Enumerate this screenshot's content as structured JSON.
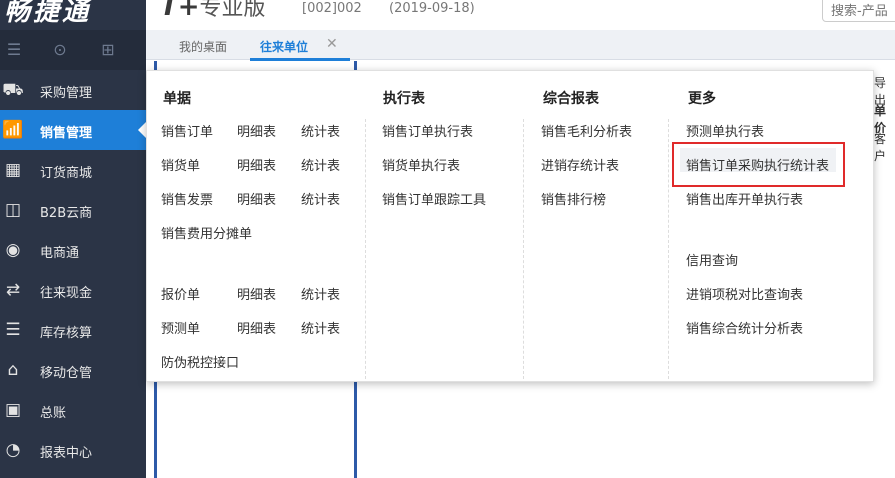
{
  "header": {
    "logo": "畅捷通",
    "product": "T+",
    "edition": "专业版",
    "account": "[002]002",
    "date": "(2019-09-18)",
    "search_placeholder": "搜索-产品"
  },
  "sidebar": {
    "items": [
      {
        "label": "采购管理",
        "icon": "purchase-cart-icon"
      },
      {
        "label": "销售管理",
        "icon": "sales-chart-icon",
        "active": true
      },
      {
        "label": "订货商城",
        "icon": "store-icon"
      },
      {
        "label": "B2B云商",
        "icon": "b2b-bag-icon"
      },
      {
        "label": "电商通",
        "icon": "ecommerce-icon"
      },
      {
        "label": "往来现金",
        "icon": "exchange-icon"
      },
      {
        "label": "库存核算",
        "icon": "inventory-icon"
      },
      {
        "label": "移动仓管",
        "icon": "mobile-warehouse-icon"
      },
      {
        "label": "总账",
        "icon": "ledger-icon"
      },
      {
        "label": "报表中心",
        "icon": "report-pie-icon"
      }
    ]
  },
  "tabs": {
    "home": "我的桌面",
    "current": "往来单位"
  },
  "background": {
    "frag1": "导出",
    "frag2": "单价",
    "frag3": "客户"
  },
  "menu": {
    "col1": {
      "title": "单据",
      "r1": [
        "销售订单",
        "明细表",
        "统计表"
      ],
      "r2": [
        "销货单",
        "明细表",
        "统计表"
      ],
      "r3": [
        "销售发票",
        "明细表",
        "统计表"
      ],
      "r4": "销售费用分摊单",
      "r5": [
        "报价单",
        "明细表",
        "统计表"
      ],
      "r6": [
        "预测单",
        "明细表",
        "统计表"
      ],
      "r7": "防伪税控接口"
    },
    "col2": {
      "title": "执行表",
      "items": [
        "销售订单执行表",
        "销货单执行表",
        "销售订单跟踪工具"
      ]
    },
    "col3": {
      "title": "综合报表",
      "items": [
        "销售毛利分析表",
        "进销存统计表",
        "销售排行榜"
      ]
    },
    "col4": {
      "title": "更多",
      "items": [
        "预测单执行表",
        "销售订单采购执行统计表",
        "销售出库开单执行表",
        "信用查询",
        "进销项税对比查询表",
        "销售综合统计分析表"
      ]
    }
  },
  "colors": {
    "sidebar_bg": "#2b3446",
    "active_blue": "#1e7fd8",
    "highlight_red": "#e02a2a"
  }
}
